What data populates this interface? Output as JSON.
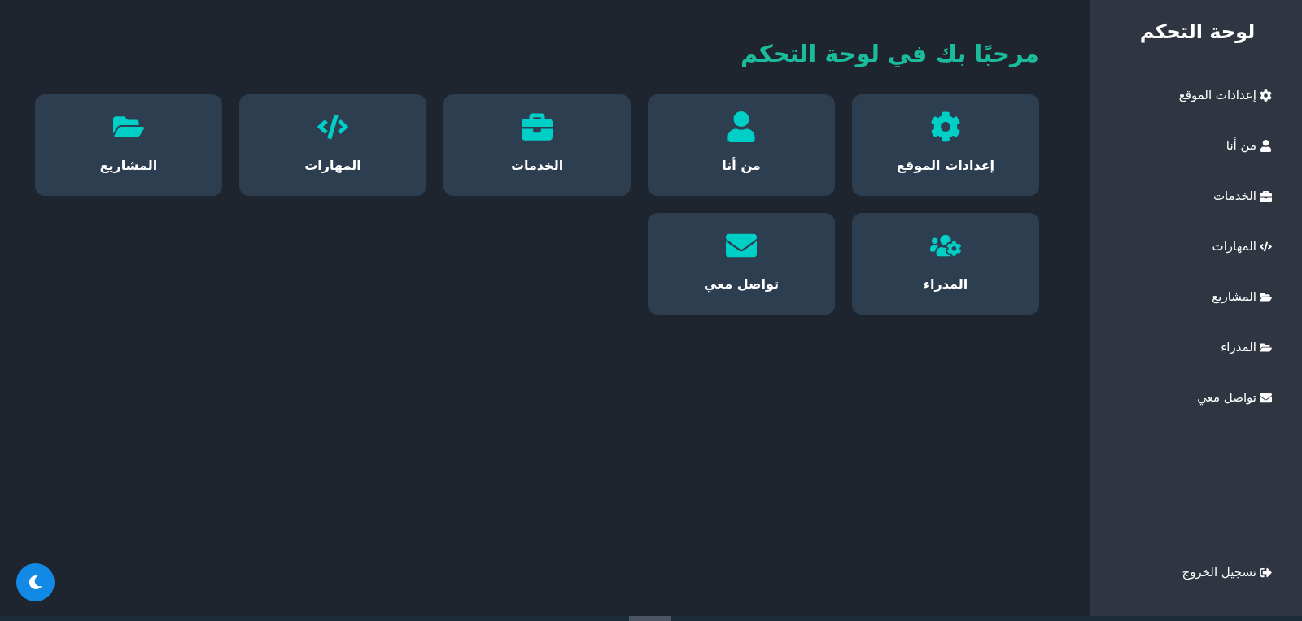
{
  "sidebar": {
    "title": "لوحة التحكم",
    "items": [
      {
        "label": "إعدادات الموقع"
      },
      {
        "label": "من أنا"
      },
      {
        "label": "الخدمات"
      },
      {
        "label": "المهارات"
      },
      {
        "label": "المشاريع"
      },
      {
        "label": "المدراء"
      },
      {
        "label": "تواصل معي"
      }
    ],
    "logout": "تسجيل الخروج"
  },
  "main": {
    "heading": "مرحبًا بك في لوحة التحكم",
    "cards": [
      {
        "label": "إعدادات الموقع"
      },
      {
        "label": "من أنا"
      },
      {
        "label": "الخدمات"
      },
      {
        "label": "المهارات"
      },
      {
        "label": "المشاريع"
      },
      {
        "label": "المدراء"
      },
      {
        "label": "تواصل معي"
      }
    ]
  }
}
